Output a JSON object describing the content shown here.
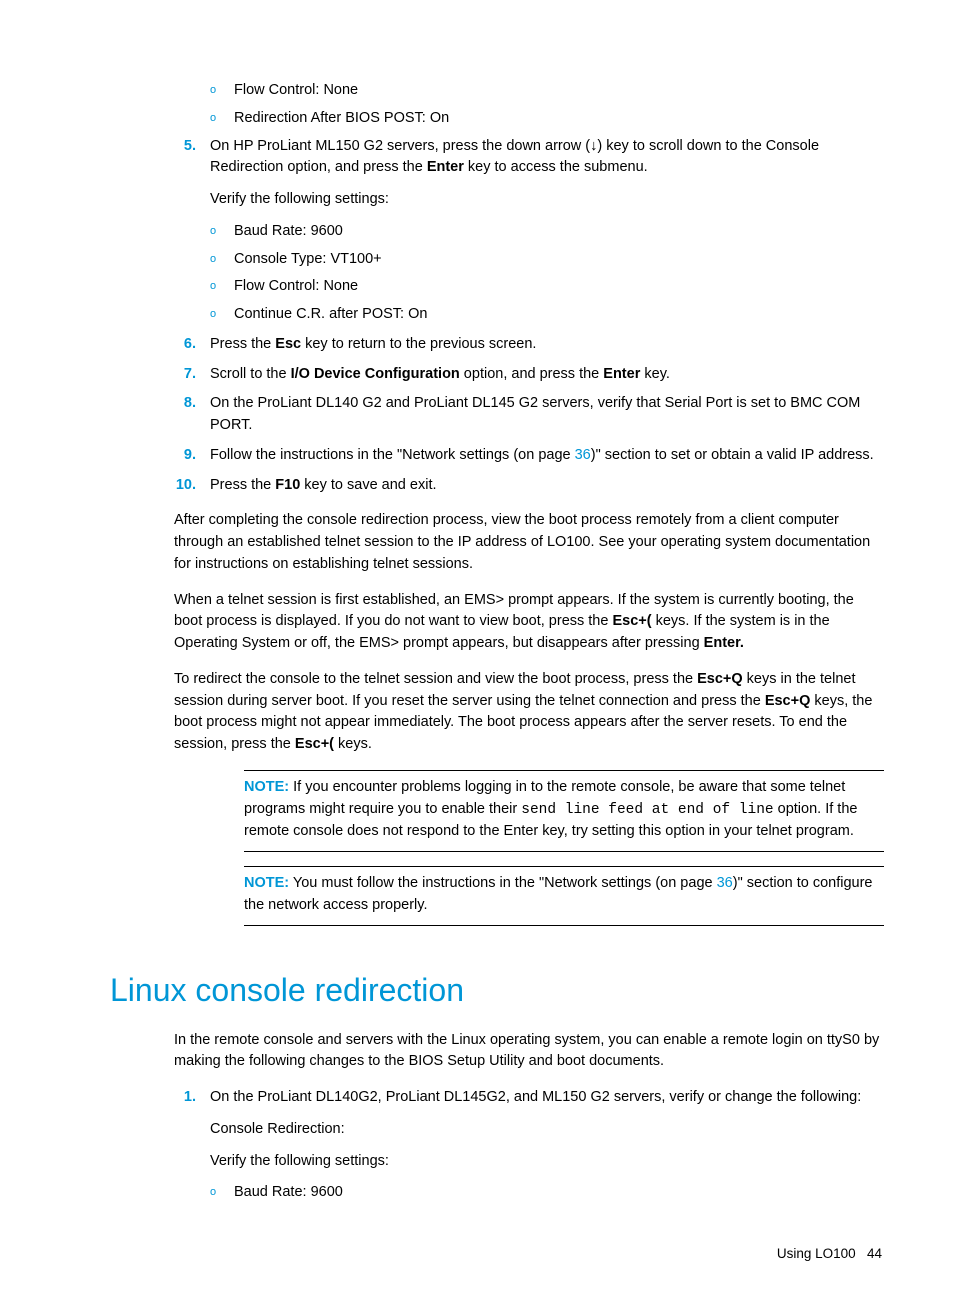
{
  "topSubItems": [
    "Flow Control: None",
    "Redirection After BIOS POST: On"
  ],
  "step5": {
    "num": "5.",
    "part1": "On HP ProLiant ML150 G2 servers, press the down arrow (↓) key to scroll down to the Console Redirection option, and press the ",
    "bold1": "Enter",
    "part2": " key to access the submenu.",
    "verify": "Verify the following settings:",
    "subs": [
      "Baud Rate: 9600",
      "Console Type: VT100+",
      "Flow Control: None",
      "Continue C.R. after POST: On"
    ]
  },
  "step6": {
    "num": "6.",
    "part1": "Press the ",
    "bold1": "Esc",
    "part2": " key to return to the previous screen."
  },
  "step7": {
    "num": "7.",
    "part1": "Scroll to the ",
    "bold1": "I/O Device Configuration",
    "part2": " option, and press the ",
    "bold2": "Enter",
    "part3": " key."
  },
  "step8": {
    "num": "8.",
    "text": "On the ProLiant DL140 G2 and ProLiant DL145 G2 servers, verify that Serial Port is set to BMC COM PORT."
  },
  "step9": {
    "num": "9.",
    "part1": "Follow the instructions in the \"Network settings (on page ",
    "link": "36",
    "part2": ")\" section to set or obtain a valid IP address."
  },
  "step10": {
    "num": "10.",
    "part1": "Press the ",
    "bold1": "F10",
    "part2": " key to save and exit."
  },
  "para1": "After completing the console redirection process, view the boot process remotely from a client computer through an established telnet session to the IP address of LO100. See your operating system documentation for instructions on establishing telnet sessions.",
  "para2": {
    "p1": "When a telnet session is first established, an EMS> prompt appears. If the system is currently booting, the boot process is displayed. If you do not want to view boot, press the ",
    "b1": "Esc+(",
    "p2": " keys. If the system is in the Operating System or off, the EMS> prompt appears, but disappears after pressing ",
    "b2": "Enter."
  },
  "para3": {
    "p1": "To redirect the console to the telnet session and view the boot process, press the ",
    "b1": "Esc+Q",
    "p2": " keys in the telnet session during server boot. If you reset the server using the telnet connection and press the ",
    "b2": "Esc+Q",
    "p3": " keys, the boot process might not appear immediately. The boot process appears after the server resets. To end the session, press the ",
    "b3": "Esc+(",
    "p4": " keys."
  },
  "note1": {
    "label": "NOTE:",
    "p1": "  If you encounter problems logging in to the remote console, be aware that some telnet programs might require you to enable their ",
    "mono": "send line feed at end of line",
    "p2": " option. If the remote console does not respond to the Enter key, try setting this option in your telnet program."
  },
  "note2": {
    "label": "NOTE:",
    "p1": "  You must follow the instructions in the \"Network settings (on page ",
    "link": "36",
    "p2": ")\" section to configure the network access properly."
  },
  "sectionTitle": "Linux console redirection",
  "linuxIntro": "In the remote console and servers with the Linux operating system, you can enable a remote login on ttyS0 by making the following changes to the BIOS Setup Utility and boot documents.",
  "linuxStep1": {
    "num": "1.",
    "text": "On the ProLiant DL140G2, ProLiant DL145G2, and ML150 G2 servers, verify or change the following:",
    "line1": "Console Redirection:",
    "line2": "Verify the following settings:",
    "subs": [
      "Baud Rate: 9600"
    ]
  },
  "footer": {
    "label": "Using LO100",
    "page": "44"
  }
}
